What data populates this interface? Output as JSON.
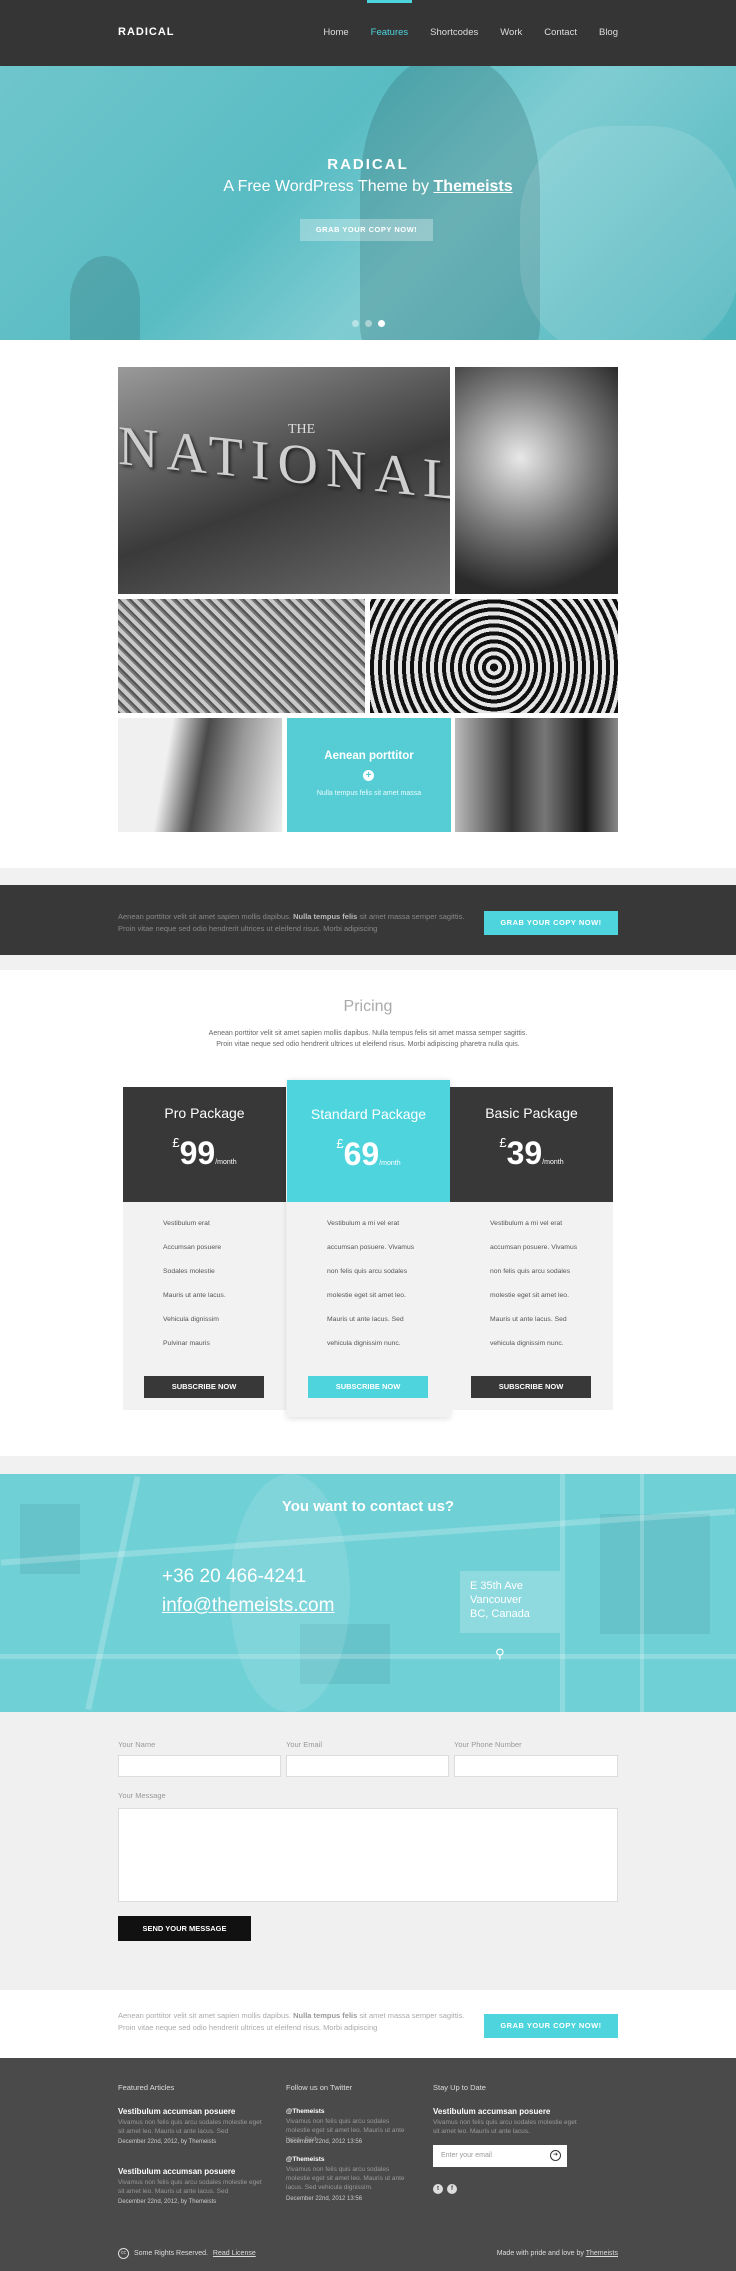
{
  "header": {
    "logo": "RADICAL",
    "nav": [
      "Home",
      "Features",
      "Shortcodes",
      "Work",
      "Contact",
      "Blog"
    ],
    "active_nav": "Features"
  },
  "hero": {
    "title": "RADICAL",
    "subtitle_prefix": "A Free WordPress Theme by",
    "subtitle_link": "Themeists",
    "button": "GRAB YOUR COPY NOW!",
    "slides": 3,
    "active_slide": 3
  },
  "gallery": {
    "sign_the": "THE",
    "sign_word": "NATIONAL",
    "overlay_title": "Aenean porttitor",
    "overlay_text": "Nulla tempus felis sit amet massa"
  },
  "banner": {
    "text_a": "Aenean porttitor velit sit amet sapien mollis dapibus.",
    "text_bold": "Nulla tempus felis",
    "text_b": "sit amet massa semper sagittis. Proin vitae neque sed odio hendrerit ultrices ut eleifend risus. Morbi adipiscing",
    "button": "GRAB YOUR COPY NOW!"
  },
  "pricing": {
    "title": "Pricing",
    "description": "Aenean porttitor velit sit amet sapien mollis dapibus. Nulla tempus felis sit amet massa semper sagittis. Proin vitae neque sed odio hendrerit ultrices ut eleifend risus. Morbi adipiscing pharetra nulla quis.",
    "plans": [
      {
        "name": "Pro Package",
        "currency": "£",
        "amount": "99",
        "period": "/month",
        "features": [
          "Vestibulum erat",
          "Accumsan posuere",
          "Sodales molestie",
          "Mauris ut ante lacus.",
          "Vehicula dignissim",
          "Pulvinar mauris"
        ],
        "button": "SUBSCRIBE NOW"
      },
      {
        "name": "Standard Package",
        "currency": "£",
        "amount": "69",
        "period": "/month",
        "features": [
          "Vestibulum a mi vel erat",
          "accumsan posuere. Vivamus",
          "non felis quis arcu sodales",
          "molestie eget sit amet leo.",
          "Mauris ut ante lacus. Sed",
          "vehicula dignissim nunc."
        ],
        "button": "SUBSCRIBE NOW"
      },
      {
        "name": "Basic Package",
        "currency": "£",
        "amount": "39",
        "period": "/month",
        "features": [
          "Vestibulum a mi vel erat",
          "accumsan posuere. Vivamus",
          "non felis quis arcu sodales",
          "molestie eget sit amet leo.",
          "Mauris ut ante lacus. Sed",
          "vehicula dignissim nunc."
        ],
        "button": "SUBSCRIBE NOW"
      }
    ]
  },
  "contact": {
    "title": "You want to contact us?",
    "phone": "+36 20 466-4241",
    "email": "info@themeists.com",
    "address": [
      "E 35th Ave",
      "Vancouver",
      "BC, Canada"
    ]
  },
  "form": {
    "name_label": "Your Name",
    "email_label": "Your Email",
    "phone_label": "Your Phone Number",
    "message_label": "Your Message",
    "send_button": "SEND YOUR MESSAGE"
  },
  "banner2": {
    "text_a": "Aenean porttitor velit sit amet sapien mollis dapibus.",
    "text_bold": "Nulla tempus felis",
    "text_b": "sit amet massa semper sagittis. Proin vitae neque sed odio hendrerit ultrices ut eleifend risus. Morbi adipiscing",
    "button": "GRAB YOUR COPY NOW!"
  },
  "footer": {
    "articles_heading": "Featured Articles",
    "articles": [
      {
        "title": "Vestibulum accumsan posuere",
        "body": "Vivamus non felis quis arcu sodales molestie eget sit amet leo. Mauris ut ante lacus. Sed",
        "date": "December 22nd, 2012, by Themeists"
      },
      {
        "title": "Vestibulum accumsan posuere",
        "body": "Vivamus non felis quis arcu sodales molestie eget sit amet leo. Mauris ut ante lacus. Sed",
        "date": "December 22nd, 2012, by Themeists"
      }
    ],
    "twitter_heading": "Follow us on Twitter",
    "tweets": [
      {
        "handle": "@Themeists",
        "body": "Vivamus non felis quis arcu sodales molestie eget sit amet leo. Mauris ut ante lacus. Sed",
        "date": "December 22nd, 2012 13:56"
      },
      {
        "handle": "@Themeists",
        "body": "Vivamus non felis quis arcu sodales molestie eget sit amet leo. Mauris ut ante lacus. Sed vehicula dignissim.",
        "date": "December 22nd, 2012 13:56"
      }
    ],
    "newsletter_heading": "Stay Up to Date",
    "newsletter_title": "Vestibulum accumsan posuere",
    "newsletter_body": "Vivamus non felis quis arcu sodales molestie eget sit amet leo. Mauris ut ante lacus.",
    "email_placeholder": "Enter your email",
    "copyright": "Some Rights Reserved.",
    "license": "Read License",
    "made_by": "Made with pride and love by",
    "made_link": "Themeists"
  },
  "colors": {
    "accent": "#4dd4dd",
    "dark": "#383838",
    "footer": "#4a4a4a"
  }
}
